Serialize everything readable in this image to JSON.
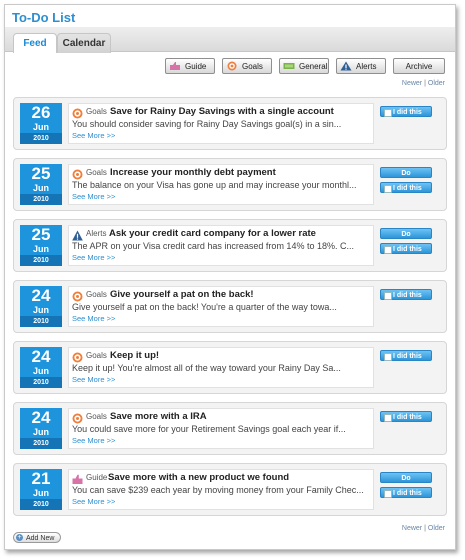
{
  "app": {
    "title": "To-Do List"
  },
  "tabs": [
    {
      "label": "Feed"
    },
    {
      "label": "Calendar"
    }
  ],
  "filters": [
    {
      "label": "Guide",
      "icon": "guide-icon"
    },
    {
      "label": "Goals",
      "icon": "goals-icon"
    },
    {
      "label": "General",
      "icon": "general-icon"
    },
    {
      "label": "Alerts",
      "icon": "alerts-icon"
    },
    {
      "label": "Archive"
    }
  ],
  "pager": {
    "newer": "Newer",
    "sep": "|",
    "older": "Older"
  },
  "items": [
    {
      "day": "26",
      "month": "Jun",
      "year": "2010",
      "category": "Goals",
      "category_icon": "goals-icon",
      "title": "Save for Rainy Day Savings with a single account",
      "desc": "You should consider saving for Rainy Day Savings goal(s) in a sin...",
      "more": "See More >>",
      "do": null,
      "did": "I did this"
    },
    {
      "day": "25",
      "month": "Jun",
      "year": "2010",
      "category": "Goals",
      "category_icon": "goals-icon",
      "title": "Increase your monthly debt payment",
      "desc": "The balance on your Visa has gone up and may increase your monthl...",
      "more": "See More >>",
      "do": "Do",
      "did": "I did this"
    },
    {
      "day": "25",
      "month": "Jun",
      "year": "2010",
      "category": "Alerts",
      "category_icon": "alerts-icon",
      "title": "Ask your credit card company for a lower rate",
      "desc": "The APR on your Visa credit card has increased from 14% to 18%. C...",
      "more": "See More >>",
      "do": "Do",
      "did": "I did this"
    },
    {
      "day": "24",
      "month": "Jun",
      "year": "2010",
      "category": "Goals",
      "category_icon": "goals-icon",
      "title": "Give yourself a pat on the back!",
      "desc": "Give yourself a pat on the back! You're a quarter of the way towa...",
      "more": "See More >>",
      "do": null,
      "did": "I did this"
    },
    {
      "day": "24",
      "month": "Jun",
      "year": "2010",
      "category": "Goals",
      "category_icon": "goals-icon",
      "title": "Keep it up!",
      "desc": "Keep it up! You're almost all of the way toward your Rainy Day Sa...",
      "more": "See More >>",
      "do": null,
      "did": "I did this"
    },
    {
      "day": "24",
      "month": "Jun",
      "year": "2010",
      "category": "Goals",
      "category_icon": "goals-icon",
      "title": "Save more with a IRA",
      "desc": "You could save more for your Retirement Savings goal each year if...",
      "more": "See More >>",
      "do": null,
      "did": "I did this"
    },
    {
      "day": "21",
      "month": "Jun",
      "year": "2010",
      "category": "Guide",
      "category_icon": "guide-icon",
      "title": "Save more with a new product we found",
      "desc": "You can save $239 each year by moving money from your Family Chec...",
      "more": "See More >>",
      "do": "Do",
      "did": "I did this"
    }
  ],
  "footer": {
    "add_new": "Add New"
  },
  "colors": {
    "accent": "#2e8fd0",
    "date_blue": "#1d94db",
    "date_dark": "#1574b5",
    "button_blue": "#3aa2e0"
  }
}
